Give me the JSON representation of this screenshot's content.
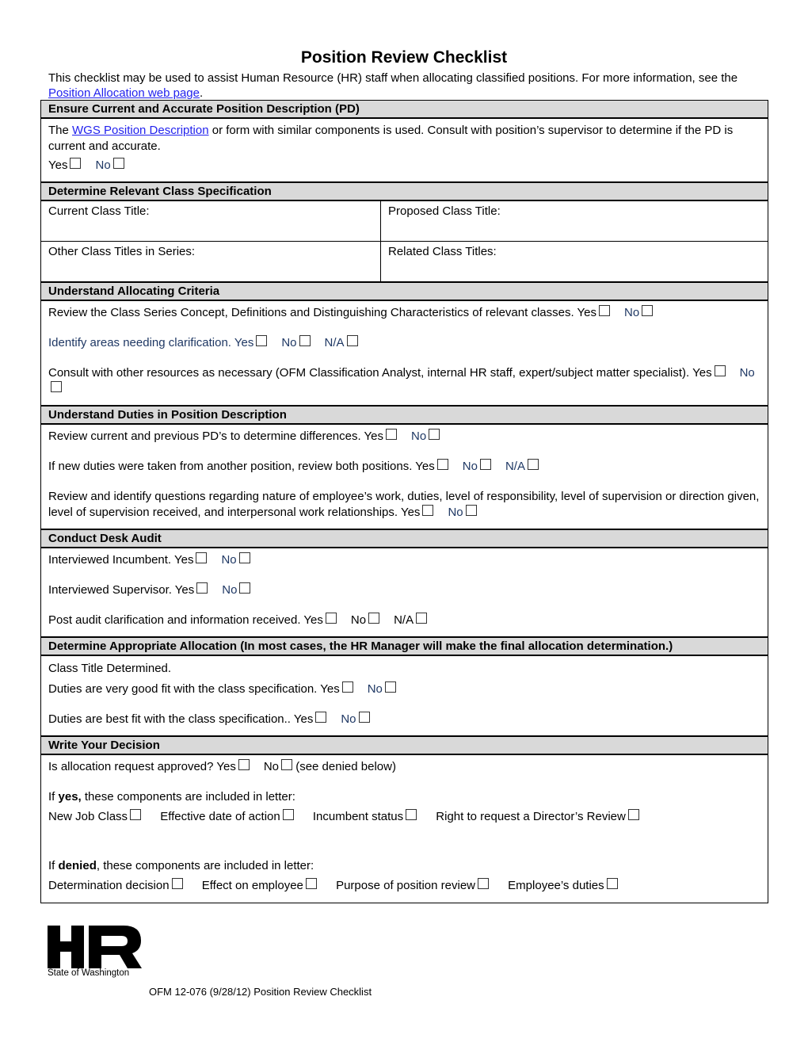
{
  "title": "Position Review Checklist",
  "intro": {
    "text_before": "This checklist may be used to assist Human Resource (HR) staff when allocating classified positions. For more information, see the ",
    "link": "Position Allocation web page",
    "text_after": "."
  },
  "sections": {
    "pd": {
      "heading": "Ensure Current and Accurate Position Description (PD)",
      "text_before": "The ",
      "link": "WGS Position Description",
      "text_after": " or form with similar components is used. Consult with position’s supervisor to determine if the PD is current and accurate.",
      "yes": "Yes",
      "no": "No"
    },
    "class_spec": {
      "heading": "Determine Relevant Class Specification",
      "current": "Current Class Title:",
      "proposed": "Proposed Class Title:",
      "other": "Other Class Titles in Series:",
      "related": "Related Class Titles:"
    },
    "criteria": {
      "heading": "Understand Allocating Criteria",
      "items": [
        {
          "text": "Review the Class Series Concept, Definitions and Distinguishing Characteristics of relevant classes. Yes",
          "no": "No"
        },
        {
          "text": "Identify areas needing clarification. Yes",
          "no": "No",
          "na": "N/A"
        },
        {
          "text": "Consult with other resources as necessary (OFM Classification Analyst, internal HR staff, expert/subject matter specialist). Yes",
          "no": "No"
        }
      ]
    },
    "duties": {
      "heading": "Understand Duties in Position Description",
      "items": [
        {
          "text": "Review current and previous PD’s to determine differences. Yes",
          "no": "No"
        },
        {
          "text": "If new duties were taken from another position, review both positions. Yes",
          "no": "No",
          "na": "N/A"
        },
        {
          "text": "Review and identify questions regarding nature of employee’s work, duties, level of responsibility, level of supervision or direction given, level of supervision received, and interpersonal work relationships. Yes",
          "no": "No"
        }
      ]
    },
    "audit": {
      "heading": "Conduct Desk Audit",
      "items": [
        {
          "text": "Interviewed Incumbent. Yes",
          "no": "No"
        },
        {
          "text": "Interviewed Supervisor. Yes",
          "no": "No"
        },
        {
          "text": "Post audit clarification and information received. Yes",
          "no": "No",
          "na": "N/A"
        }
      ]
    },
    "allocation": {
      "heading": "Determine Appropriate Allocation (In most cases, the HR Manager will make the final allocation determination.)",
      "intro": "Class Title Determined.",
      "items": [
        {
          "text": "Duties are very good fit with the class specification. Yes",
          "no": "No"
        },
        {
          "text": "Duties are best fit with the class specification.. Yes",
          "no": "No"
        }
      ]
    },
    "decision": {
      "heading": "Write Your Decision",
      "question": "Is allocation request approved? Yes",
      "no": "No",
      "no_note": "(see denied below)",
      "yes_prefix": "If ",
      "yes_bold": "yes,",
      "yes_suffix": " these components are included in letter:",
      "yes_items": [
        "New Job Class",
        "Effective date of action",
        "Incumbent status",
        "Right to request a Director’s Review"
      ],
      "denied_prefix": "If ",
      "denied_bold": "denied",
      "denied_suffix": ", these components are included in letter:",
      "denied_items": [
        "Determination decision",
        "Effect on employee",
        "Purpose of position review",
        "Employee’s duties"
      ]
    }
  },
  "logo": {
    "mark": "HR",
    "subtitle": "State of Washington"
  },
  "footer": "OFM 12-076 (9/28/12) Position Review Checklist"
}
